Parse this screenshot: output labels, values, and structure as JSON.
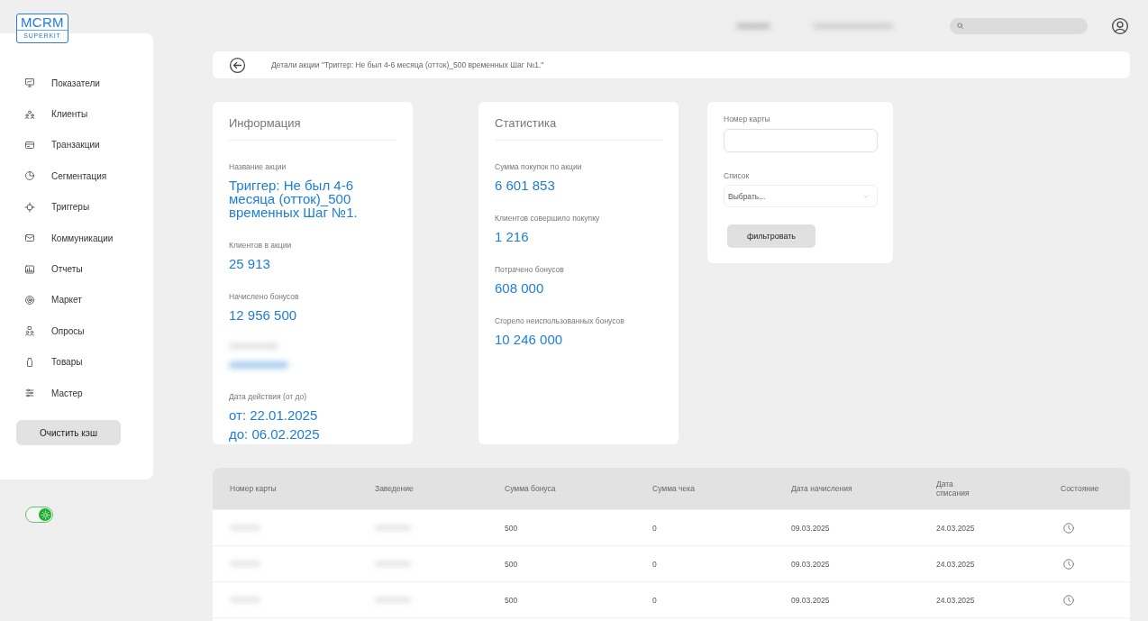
{
  "logo": {
    "title": "MCRM",
    "subtitle": "SUPERKIT"
  },
  "sidebar": {
    "items": [
      {
        "label": "Показатели"
      },
      {
        "label": "Клиенты"
      },
      {
        "label": "Транзакции"
      },
      {
        "label": "Сегментация"
      },
      {
        "label": "Триггеры"
      },
      {
        "label": "Коммуникации"
      },
      {
        "label": "Отчеты"
      },
      {
        "label": "Маркет"
      },
      {
        "label": "Опросы"
      },
      {
        "label": "Товары"
      },
      {
        "label": "Мастер"
      }
    ],
    "clear_cache_button": "Очистить кэш"
  },
  "theme_toggle": {
    "on": true
  },
  "header": {
    "title": "Детали акции \"Триггер: Не был 4-6 месяца (отток)_500 временных Шаг №1.\""
  },
  "info_card": {
    "title": "Информация",
    "fields": [
      {
        "kind": "text",
        "label": "Название акции",
        "lines": [
          "Триггер: Не был 4-6 месяца (отток)_500 временных Шаг №1."
        ]
      },
      {
        "kind": "text",
        "label": "Клиентов в акции",
        "lines": [
          "25 913"
        ]
      },
      {
        "kind": "text",
        "label": "Начислено бонусов",
        "lines": [
          "12 956 500"
        ]
      },
      {
        "kind": "redacted"
      },
      {
        "kind": "text",
        "label": "Дата действия (от до)",
        "lines": [
          "от: 22.01.2025",
          "до: 06.02.2025"
        ]
      }
    ]
  },
  "stats_card": {
    "title": "Статистика",
    "fields": [
      {
        "label": "Сумма покупок по акции",
        "value": "6 601 853"
      },
      {
        "label": "Клиентов совершило покупку",
        "value": "1 216"
      },
      {
        "label": "Потрачено бонусов",
        "value": "608 000"
      },
      {
        "label": "Сгорело неиспользованных бонусов",
        "value": "10 246 000"
      }
    ]
  },
  "filter_card": {
    "card_label": "Номер карты",
    "list_label": "Список",
    "list_value": "Выбрать...",
    "button": "фильтровать"
  },
  "table": {
    "columns": [
      "Номер карты",
      "Заведение",
      "Сумма бонуса",
      "Сумма чека",
      "Дата начисления",
      "Дата списания",
      "Состояние"
    ],
    "rows": [
      {
        "bonus": "500",
        "check": "0",
        "accrual_date": "09.03.2025",
        "writeoff_date": "24.03.2025",
        "kind": "pending"
      },
      {
        "bonus": "500",
        "check": "0",
        "accrual_date": "09.03.2025",
        "writeoff_date": "24.03.2025",
        "kind": "pending"
      },
      {
        "bonus": "500",
        "check": "0",
        "accrual_date": "09.03.2025",
        "writeoff_date": "24.03.2025",
        "kind": "pending"
      }
    ]
  }
}
